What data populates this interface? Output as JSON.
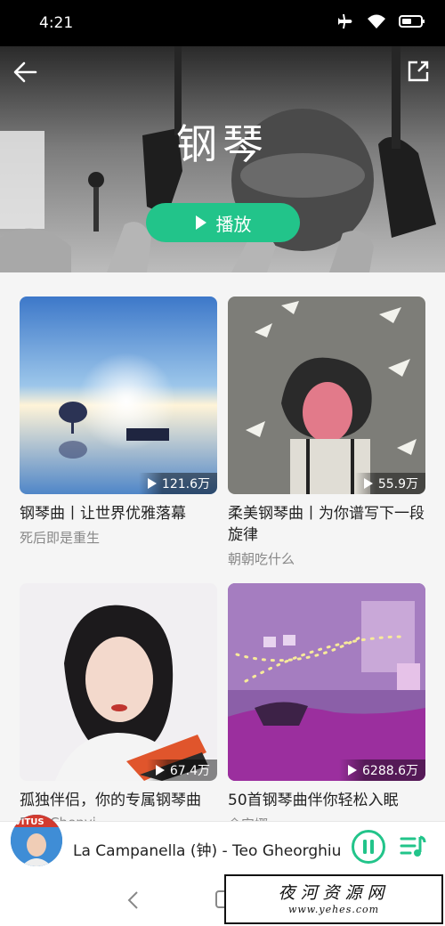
{
  "status_bar": {
    "time": "4:21",
    "icons": [
      "airplane-icon",
      "wifi-icon",
      "battery-icon"
    ]
  },
  "header": {
    "title": "钢琴",
    "play_label": "播放",
    "accent": "#22c48a"
  },
  "playlists": [
    {
      "title": "钢琴曲丨让世界优雅落幕",
      "creator": "死后即是重生",
      "plays": "121.6万"
    },
    {
      "title": "柔美钢琴曲丨为你谱写下一段旋律",
      "creator": "朝朝吃什么",
      "plays": "55.9万"
    },
    {
      "title": "孤独伴侣，你的专属钢琴曲",
      "creator": "Eriu Chenyi",
      "plays": "67.4万"
    },
    {
      "title": "50首钢琴曲伴你轻松入眠",
      "creator": "余安娜",
      "plays": "6288.6万"
    }
  ],
  "player": {
    "title": "La Campanella (钟) - Teo Gheorghiu",
    "thumb_text": "VITUS"
  },
  "watermark": {
    "main": "夜河资源网",
    "url": "www.yehes.com"
  }
}
